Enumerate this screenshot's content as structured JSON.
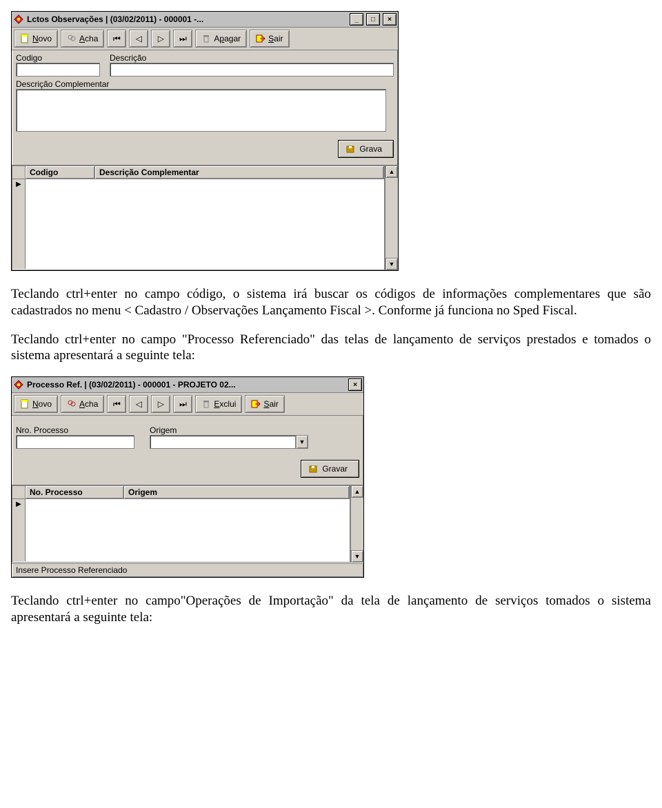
{
  "window1": {
    "title": "Lctos Observações | (03/02/2011) - 000001 -...",
    "toolbar": {
      "novo": "Novo",
      "acha": "Acha",
      "apagar": "Apagar",
      "sair": "Sair"
    },
    "labels": {
      "codigo": "Codigo",
      "descricao": "Descrição",
      "desc_compl": "Descrição Complementar"
    },
    "fields": {
      "codigo": "",
      "descricao": "",
      "desc_compl": ""
    },
    "save_label": "Grava",
    "grid": {
      "col1": "Codigo",
      "col2": "Descrição Complementar"
    }
  },
  "para1": "Teclando ctrl+enter no campo código, o sistema irá buscar os códigos de informações complementares que são cadastrados no menu < Cadastro / Observações Lançamento Fiscal >. Conforme já funciona no Sped Fiscal.",
  "para2": "Teclando ctrl+enter no campo \"Processo Referenciado\" das telas de lançamento de serviços prestados e tomados o sistema apresentará a seguinte tela:",
  "window2": {
    "title": "Processo Ref. | (03/02/2011) - 000001 - PROJETO 02...",
    "toolbar": {
      "novo": "Novo",
      "acha": "Acha",
      "exclui": "Exclui",
      "sair": "Sair"
    },
    "labels": {
      "nro_proc": "Nro. Processo",
      "origem": "Origem"
    },
    "fields": {
      "nro_proc": "",
      "origem": ""
    },
    "save_label": "Gravar",
    "grid": {
      "col1": "No. Processo",
      "col2": "Origem"
    },
    "status": "Insere Processo Referenciado"
  },
  "para3": "Teclando ctrl+enter no campo\"Operações de Importação\" da tela de lançamento de serviços tomados o sistema apresentará a seguinte tela:"
}
